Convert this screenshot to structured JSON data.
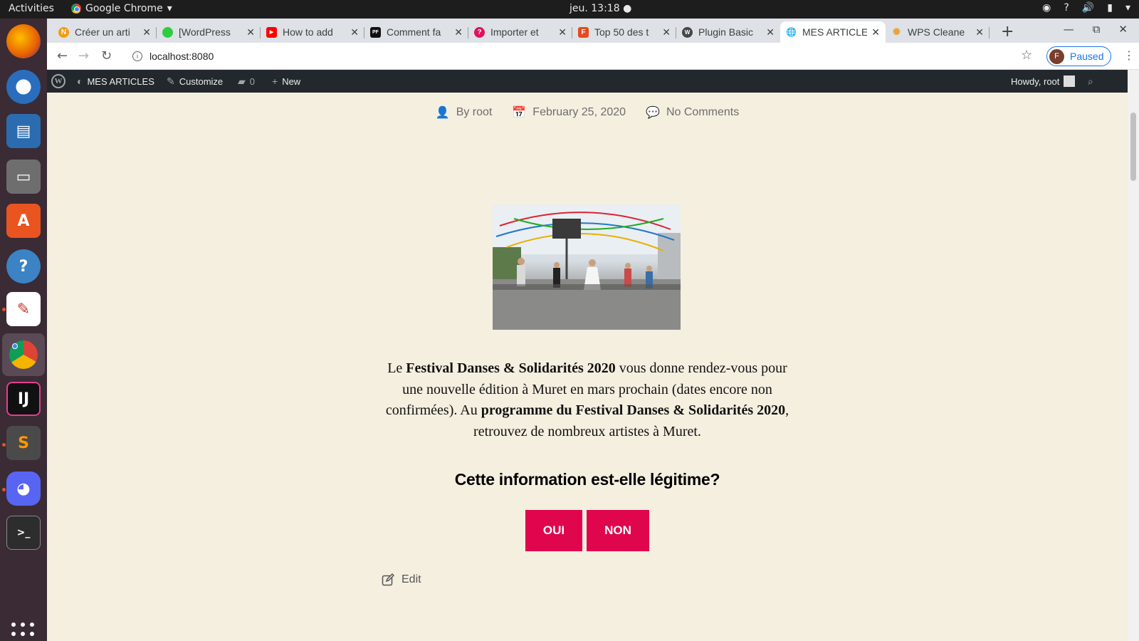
{
  "system": {
    "activities": "Activities",
    "app_name": "Google Chrome",
    "clock": "jeu. 13:18 ●"
  },
  "browser": {
    "tabs": [
      {
        "title": "Créer un arti",
        "favicon_color": "#f39c12",
        "favicon_letter": "N"
      },
      {
        "title": "[WordPress",
        "favicon_color": "#2ecc40",
        "favicon_letter": ""
      },
      {
        "title": "How to add",
        "favicon_color": "#ff0000",
        "favicon_letter": "▶"
      },
      {
        "title": "Comment fa",
        "favicon_color": "#111111",
        "favicon_letter": "PF"
      },
      {
        "title": "Importer et",
        "favicon_color": "#e0115f",
        "favicon_letter": "?"
      },
      {
        "title": "Top 50 des t",
        "favicon_color": "#e8491d",
        "favicon_letter": "F"
      },
      {
        "title": "Plugin Basic",
        "favicon_color": "#464646",
        "favicon_letter": "W"
      },
      {
        "title": "MES ARTICLE",
        "favicon_color": "#5f6368",
        "favicon_letter": "🌐"
      },
      {
        "title": "WPS Cleane",
        "favicon_color": "#e8a33d",
        "favicon_letter": "✺"
      }
    ],
    "active_tab_index": 7,
    "url": "localhost:8080",
    "profile_initial": "F",
    "profile_status": "Paused"
  },
  "adminbar": {
    "site_name": "MES ARTICLES",
    "customize": "Customize",
    "comments_count": "0",
    "new_label": "New",
    "howdy": "Howdy, root"
  },
  "post": {
    "author": "By root",
    "date": "February 25, 2020",
    "comments": "No Comments",
    "para_1": "Le ",
    "para_2": "Festival Danses & Solidarités 2020",
    "para_3": " vous donne rendez-vous pour une nouvelle édition à Muret en mars prochain (dates encore non confirmées). Au ",
    "para_4": "programme du Festival Danses & Solidarités 2020",
    "para_5": ", retrouvez de nombreux artistes à Muret.",
    "question": "Cette information est-elle légitime?",
    "yes_label": "OUI",
    "no_label": "NON",
    "edit_label": "Edit"
  },
  "colors": {
    "accent": "#e0064d",
    "page_bg": "#f5efe0",
    "adminbar_bg": "#23282d"
  }
}
